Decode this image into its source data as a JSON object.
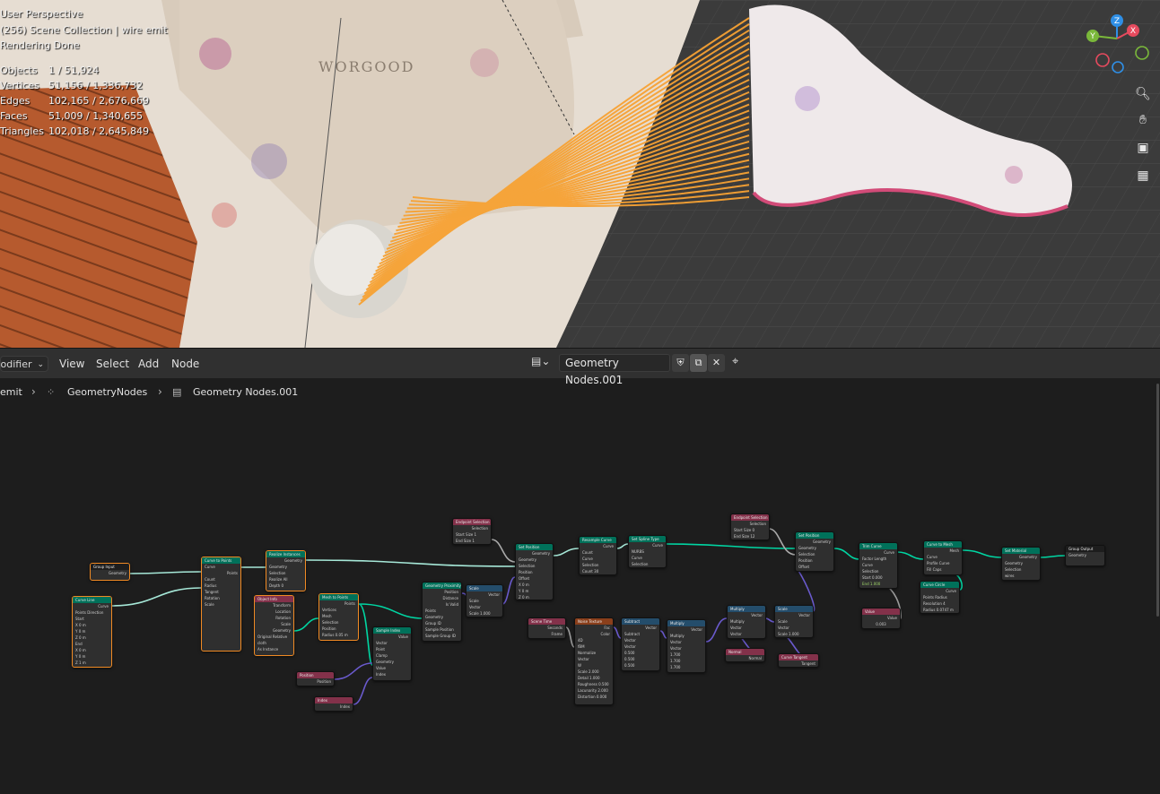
{
  "viewport": {
    "overlay": {
      "perspective": "User Perspective",
      "collection": "(256) Scene Collection | wire emit",
      "status": "Rendering Done"
    },
    "stats": [
      {
        "label": "Objects",
        "value": "1 / 51,924"
      },
      {
        "label": "Vertices",
        "value": "51,156 / 1,336,732"
      },
      {
        "label": "Edges",
        "value": "102,165 / 2,676,669"
      },
      {
        "label": "Faces",
        "value": "51,009 / 1,340,655"
      },
      {
        "label": "Triangles",
        "value": "102,018 / 2,645,849"
      }
    ],
    "box_text": "WORGOOD",
    "gizmo": {
      "x": "X",
      "y": "Y",
      "z": "Z"
    },
    "tools": [
      "zoom-icon",
      "hand-pan-icon",
      "camera-icon",
      "grid-view-icon"
    ],
    "colors": {
      "wire": "#f7a233",
      "floor": "#3b3b3b",
      "box": "#b65a2e"
    }
  },
  "header": {
    "editor_dropdown": "Modifier",
    "menus": [
      "View",
      "Select",
      "Add",
      "Node"
    ],
    "node_tree": "Geometry Nodes.001"
  },
  "breadcrumb": [
    "emit",
    "GeometryNodes",
    "Geometry Nodes.001"
  ],
  "nodes": {
    "group_input": {
      "title": "Group Input",
      "rows": [
        "Geometry"
      ]
    },
    "curve_line": {
      "title": "Curve Line",
      "rows": [
        "Curve",
        "Points  Direction",
        "Start",
        "X  0 m",
        "Y  0 m",
        "Z  0 m",
        "End",
        "X  0 m",
        "Y  0 m",
        "Z  1 m"
      ]
    },
    "endpoints": {
      "title": "Curve to Points",
      "rows": [
        "Curve",
        "Points",
        "Count",
        "Radius",
        "Tangent",
        "Rotation",
        "Scale"
      ]
    },
    "realize": {
      "title": "Realize Instances",
      "rows": [
        "Geometry",
        "Geometry",
        "Selection",
        "Realize All",
        "Depth  0"
      ]
    },
    "object_info": {
      "title": "Object Info",
      "rows": [
        "Transform",
        "Location",
        "Rotation",
        "Scale",
        "Geometry",
        "Original  Relative",
        "cloth",
        "As Instance"
      ]
    },
    "mesh_to_points": {
      "title": "Mesh to Points",
      "rows": [
        "Points",
        "Vertices",
        "Mesh",
        "Selection",
        "Position",
        "Radius  0.05 m"
      ]
    },
    "sample_index": {
      "title": "Sample Index",
      "rows": [
        "Value",
        "Vector",
        "Point",
        "Clamp",
        "Geometry",
        "Value",
        "Index"
      ]
    },
    "position": {
      "title": "Position",
      "rows": [
        "Position"
      ]
    },
    "index": {
      "title": "Index",
      "rows": [
        "Index"
      ]
    },
    "geo_proximity": {
      "title": "Geometry Proximity",
      "rows": [
        "Position",
        "Distance",
        "Is Valid",
        "Points",
        "Geometry",
        "Group ID",
        "Sample Position",
        "Sample Group ID"
      ]
    },
    "scale": {
      "title": "Scale",
      "rows": [
        "Vector",
        "Scale",
        "Vector",
        "Scale  1.000"
      ]
    },
    "endpoint_sel": {
      "title": "Endpoint Selection",
      "rows": [
        "Selection",
        "Start Size  1",
        "End Size  1"
      ]
    },
    "set_position": {
      "title": "Set Position",
      "rows": [
        "Geometry",
        "Geometry",
        "Selection",
        "Position",
        "Offset",
        "X  0 m",
        "Y  0 m",
        "Z  0 m"
      ]
    },
    "resample": {
      "title": "Resample Curve",
      "rows": [
        "Curve",
        "Count",
        "Curve",
        "Selection",
        "Count  30"
      ]
    },
    "spline_type": {
      "title": "Set Spline Type",
      "rows": [
        "Curve",
        "NURBS",
        "Curve",
        "Selection"
      ]
    },
    "scene_time": {
      "title": "Scene Time",
      "rows": [
        "Seconds",
        "Frame"
      ]
    },
    "noise": {
      "title": "Noise Texture",
      "rows": [
        "Fac",
        "Color",
        "4D",
        "fBM",
        "Normalize",
        "Vector",
        "W",
        "Scale  2.000",
        "Detail  1.000",
        "Roughness  0.500",
        "Lacunarity  2.000",
        "Distortion  0.000"
      ]
    },
    "subtract": {
      "title": "Subtract",
      "rows": [
        "Vector",
        "Subtract",
        "Vector",
        "Vector",
        "0.500",
        "0.500",
        "0.500"
      ]
    },
    "multiply1": {
      "title": "Multiply",
      "rows": [
        "Vector",
        "Multiply",
        "Vector",
        "Vector",
        "1.700",
        "1.700",
        "1.700"
      ]
    },
    "endpoint_sel2": {
      "title": "Endpoint Selection",
      "rows": [
        "Selection",
        "Start Size  0",
        "End Size  12"
      ]
    },
    "multiply2": {
      "title": "Multiply",
      "rows": [
        "Vector",
        "Multiply",
        "Vector",
        "Vector"
      ]
    },
    "normal": {
      "title": "Normal",
      "rows": [
        "Normal"
      ]
    },
    "scale2": {
      "title": "Scale",
      "rows": [
        "Vector",
        "Scale",
        "Vector",
        "Scale  1.000"
      ]
    },
    "curve_tangent": {
      "title": "Curve Tangent",
      "rows": [
        "Tangent"
      ]
    },
    "set_position2": {
      "title": "Set Position",
      "rows": [
        "Geometry",
        "Geometry",
        "Selection",
        "Position",
        "Offset"
      ]
    },
    "trim": {
      "title": "Trim Curve",
      "rows": [
        "Curve",
        "Factor  Length",
        "Curve",
        "Selection",
        "Start  0.000",
        "End  1.000"
      ]
    },
    "value": {
      "title": "Value",
      "rows": [
        "Value",
        "0.003"
      ]
    },
    "curve_to_mesh": {
      "title": "Curve to Mesh",
      "rows": [
        "Mesh",
        "Curve",
        "Profile Curve",
        "Fill Caps"
      ]
    },
    "curve_circle": {
      "title": "Curve Circle",
      "rows": [
        "Curve",
        "Points  Radius",
        "Resolution  4",
        "Radius  0.0747 m"
      ]
    },
    "set_material": {
      "title": "Set Material",
      "rows": [
        "Geometry",
        "Geometry",
        "Selection",
        "wires"
      ]
    },
    "group_output": {
      "title": "Group Output",
      "rows": [
        "Geometry"
      ]
    }
  }
}
